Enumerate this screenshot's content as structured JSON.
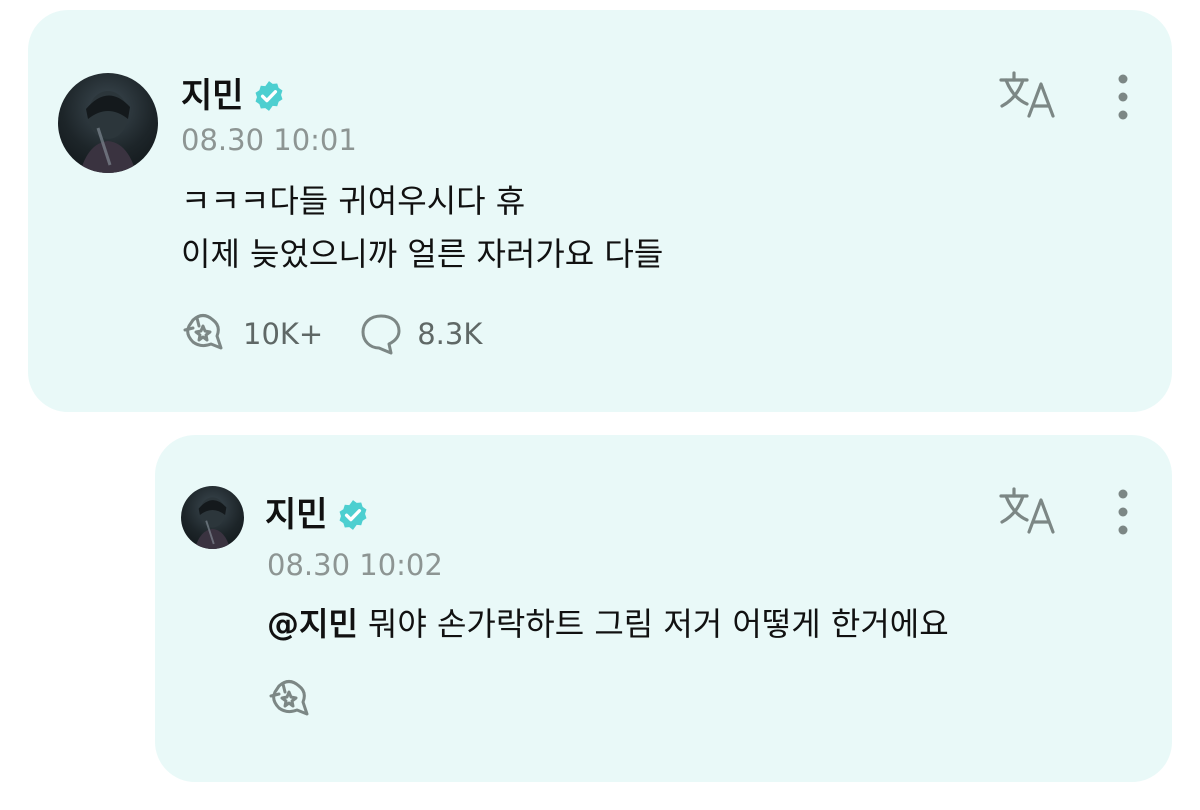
{
  "post": {
    "author": "지민",
    "timestamp": "08.30 10:01",
    "lines": [
      "ㅋㅋㅋ다들 귀여우시다 휴",
      "이제 늦었으니까 얼른 자러가요 다들"
    ],
    "like_count": "10K+",
    "comment_count": "8.3K",
    "icons": {
      "verified": "verified-badge-icon",
      "translate": "translate-icon",
      "more": "more-vertical-icon",
      "like": "like-icon",
      "comment": "comment-icon"
    }
  },
  "reply": {
    "author": "지민",
    "timestamp": "08.30 10:02",
    "mention": "@지민",
    "text": "뭐야 손가락하트 그림 저거 어떻게 한거에요",
    "icons": {
      "verified": "verified-badge-icon",
      "translate": "translate-icon",
      "more": "more-vertical-icon",
      "like": "like-icon"
    }
  },
  "colors": {
    "card_background": "#e9f9f8",
    "verified": "#4dcfd0",
    "icon": "#7c8785",
    "timestamp": "#8d9593",
    "text": "#111111"
  }
}
